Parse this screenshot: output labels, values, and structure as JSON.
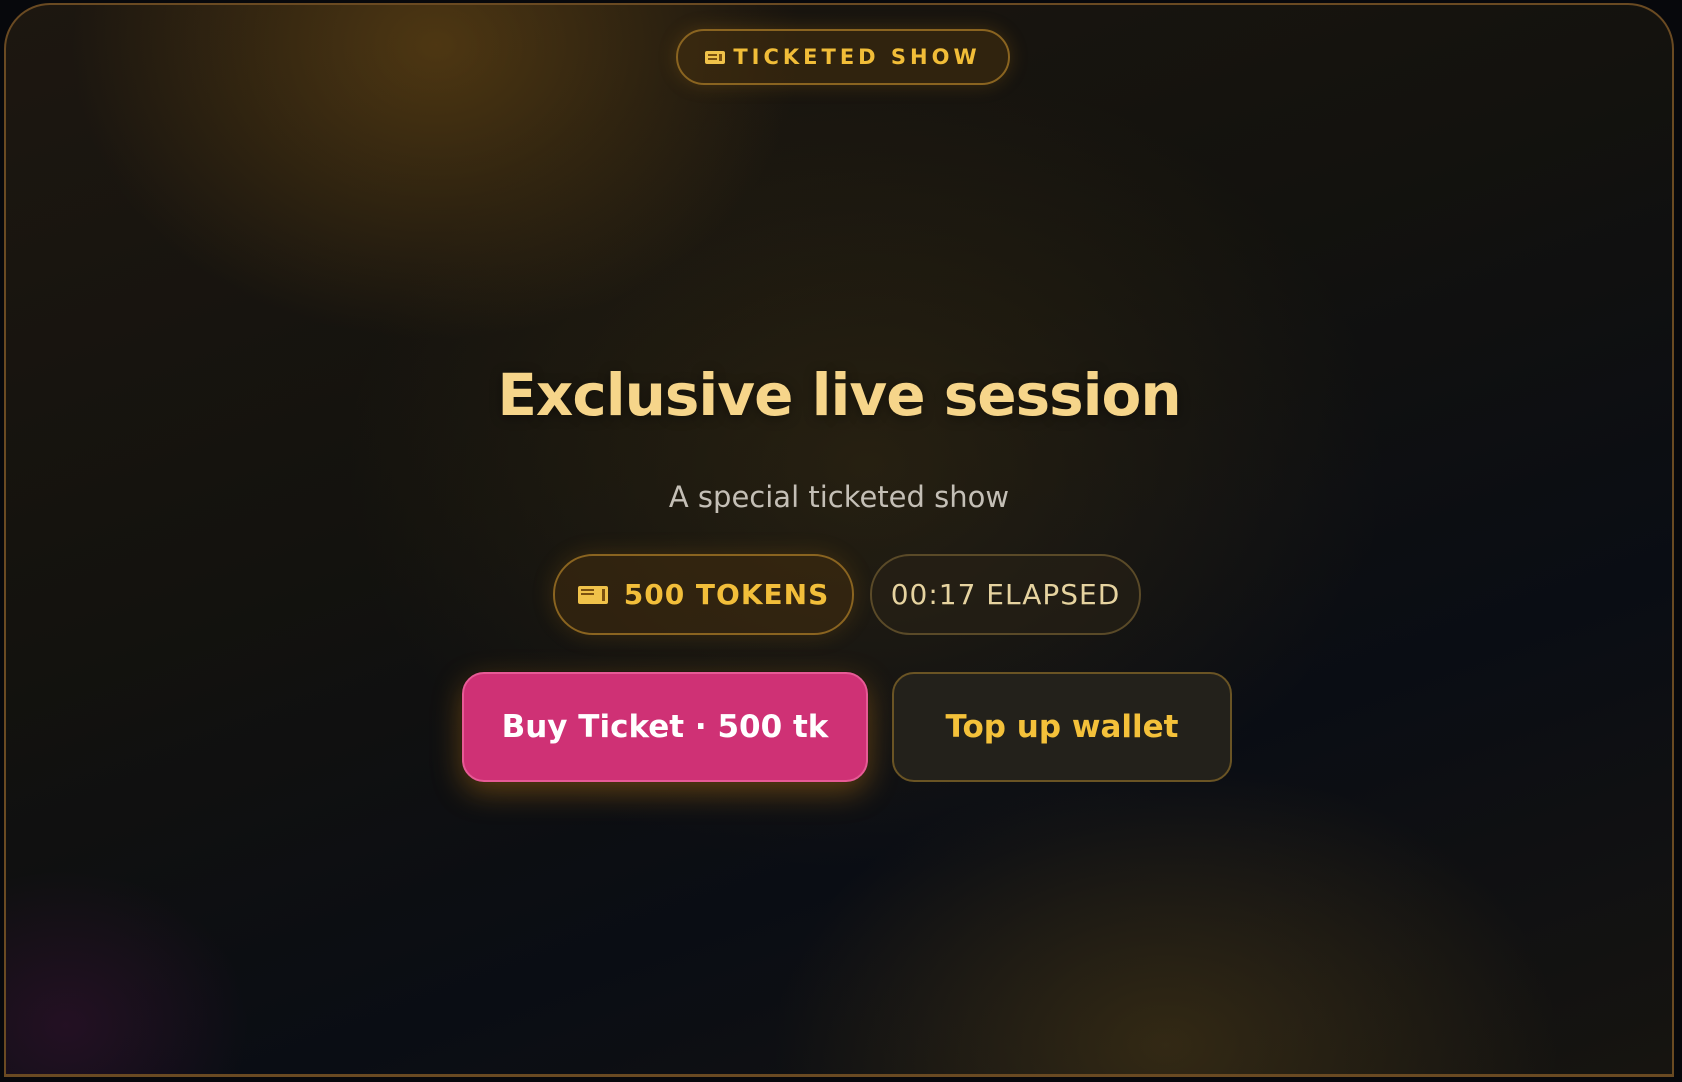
{
  "badge": {
    "icon": "ticket-icon",
    "label": "TICKETED SHOW"
  },
  "show": {
    "title": "Exclusive live session",
    "subtitle": "A special ticketed show"
  },
  "price_chip": {
    "icon": "ticket-icon",
    "label": "500 TOKENS"
  },
  "timer_chip": {
    "label": "00:17 ELAPSED"
  },
  "actions": {
    "buy_label": "Buy Ticket · 500 tk",
    "topup_label": "Top up wallet"
  },
  "colors": {
    "accent_gold": "#f2be3a",
    "title_gold": "#f6d58a",
    "primary_button": "#cf3175",
    "background": "#0a0d14"
  }
}
